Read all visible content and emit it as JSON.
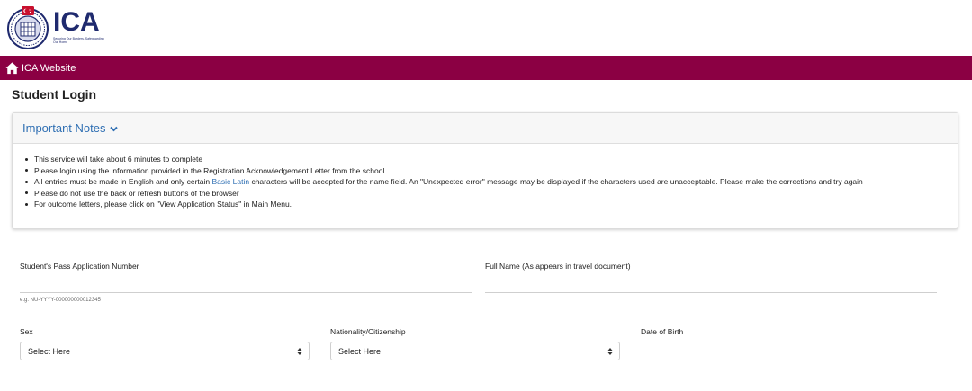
{
  "logo": {
    "word": "ICA",
    "tagline": "Securing Our Borders, Safeguarding Our Home",
    "colors": {
      "navy": "#1f2a6e",
      "red": "#c8102e"
    }
  },
  "nav": {
    "home_icon": "home-icon",
    "label": "ICA Website",
    "color": "#8b0043"
  },
  "page": {
    "title": "Student Login"
  },
  "notes": {
    "title": "Important Notes",
    "chevron_icon": "chevron-down-icon",
    "items": [
      "This service will take about 6 minutes to complete",
      "Please login using the information provided in the Registration Acknowledgement Letter from the school"
    ],
    "item3": {
      "before": "All entries must be made in English and only certain ",
      "link": "Basic Latin",
      "after": " characters will be accepted for the name field. An \"Unexpected error\" message may be displayed if the characters used are unacceptable. Please make the corrections and try again"
    },
    "items_after": [
      "Please do not use the back or refresh buttons of the browser",
      "For outcome letters, please click on \"View Application Status\" in Main Menu."
    ]
  },
  "form": {
    "pass_number": {
      "label": "Student's Pass Application Number",
      "hint": "e.g. NU-YYYY-000000000012345"
    },
    "full_name": {
      "label": "Full Name (As appears in travel document)"
    },
    "sex": {
      "label": "Sex",
      "selected": "Select Here"
    },
    "nationality": {
      "label": "Nationality/Citizenship",
      "selected": "Select Here"
    },
    "dob": {
      "label": "Date of Birth"
    }
  }
}
